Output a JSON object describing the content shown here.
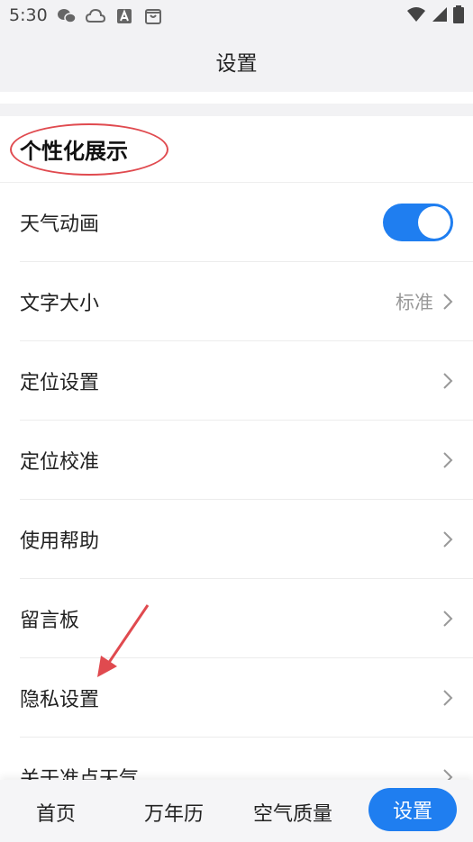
{
  "status_bar": {
    "time": "5:30",
    "left_icons": [
      "wechat-icon",
      "cloud-icon",
      "a-icon",
      "bag-icon"
    ],
    "right_icons": [
      "wifi-icon",
      "signal-icon",
      "battery-icon"
    ]
  },
  "header": {
    "title": "设置"
  },
  "section": {
    "title": "个性化展示",
    "rows": [
      {
        "label": "天气动画",
        "type": "toggle",
        "on": true
      },
      {
        "label": "文字大小",
        "type": "link",
        "value": "标准"
      },
      {
        "label": "定位设置",
        "type": "link"
      },
      {
        "label": "定位校准",
        "type": "link"
      },
      {
        "label": "使用帮助",
        "type": "link"
      },
      {
        "label": "留言板",
        "type": "link"
      },
      {
        "label": "隐私设置",
        "type": "link"
      },
      {
        "label": "关于准点天气",
        "type": "link"
      }
    ]
  },
  "bottom_nav": {
    "items": [
      "首页",
      "万年历",
      "空气质量",
      "设置"
    ],
    "active": "设置"
  },
  "colors": {
    "accent": "#1f7ef0",
    "annotation": "#e04a4f",
    "background": "#f2f2f4"
  }
}
